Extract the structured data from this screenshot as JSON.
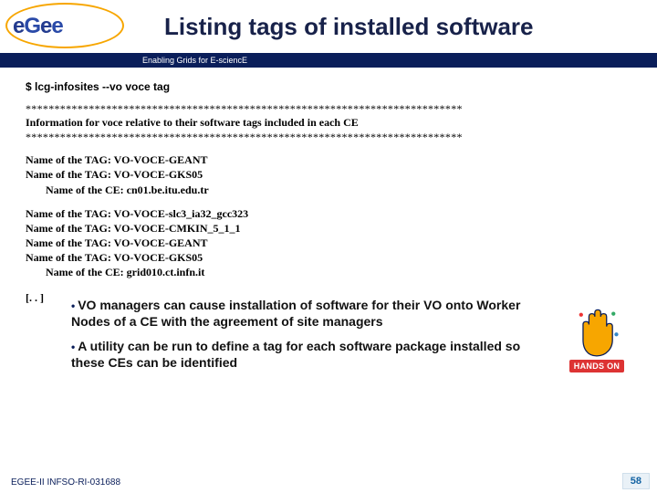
{
  "logo": {
    "text": "eGee"
  },
  "header": {
    "title": "Listing tags of installed software",
    "tagline": "Enabling Grids for E-sciencE"
  },
  "command": "$ lcg-infosites --vo voce tag",
  "separator": "****************************************************************************",
  "info_line": "Information for voce relative to their software tags included in each CE",
  "blocks": [
    {
      "tags": [
        "VO-VOCE-GEANT",
        "VO-VOCE-GKS05"
      ],
      "ce": "cn01.be.itu.edu.tr"
    },
    {
      "tags": [
        "VO-VOCE-slc3_ia32_gcc323",
        "VO-VOCE-CMKIN_5_1_1",
        "VO-VOCE-GEANT",
        "VO-VOCE-GKS05"
      ],
      "ce": "grid010.ct.infn.it"
    }
  ],
  "tag_prefix": "Name of the TAG: ",
  "ce_prefix": "Name of the CE: ",
  "ellipsis": "[. . ]",
  "bullets": [
    "VO managers can cause installation of software for their VO onto Worker Nodes of a CE with the agreement of site managers",
    "A utility can be run to define a tag for each software package installed so these CEs can be identified"
  ],
  "handson": {
    "label": "HANDS ON"
  },
  "footer": {
    "ref": "EGEE-II INFSO-RI-031688",
    "page": "58"
  }
}
